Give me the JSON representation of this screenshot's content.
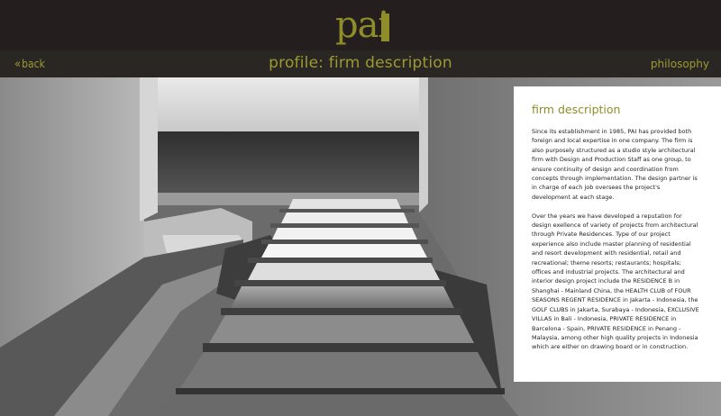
{
  "brand": {
    "logo_text": "pai",
    "accent_color": "#8f8d28"
  },
  "nav": {
    "back_label": "back",
    "back_icon": "double-chevron-left-icon",
    "title": "profile: firm description",
    "right_link": "philosophy"
  },
  "panel": {
    "title": "firm description",
    "paragraphs": [
      "Since its establishment in 1985, PAI has provided both foreign and local expertise in one company. The firm is also purposely structured as a studio style architectural firm with Design and Production Staff as one group, to ensure continuity of design and coordination from concepts through implementation. The design partner is in charge of each job oversees the project's development at each stage.",
      "Over the years we have developed a reputation for design exellence of variety of projects from architectural through Private Residences. Type of our project experience also include master planning of residential and resort development with residential, retail and recreational; theme resorts; restaurants; hospitals; offices and industrial projects. The architectural and interior design project include the RESIDENCE B in Shanghai - Mainland China, the HEALTH CLUB of FOUR SEASONS REGENT RESIDENCE in Jakarta - Indonesia, the GOLF CLUBS in Jakarta, Surabaya - Indonesia, EXCLUSIVE VILLAS in Bali - Indonesia, PRIVATE RESIDENCE in Barcelona - Spain, PRIVATE RESIDENCE in Penang - Malaysia, among other high quality projects in Indonesia which are either on drawing board or in construction."
    ]
  }
}
